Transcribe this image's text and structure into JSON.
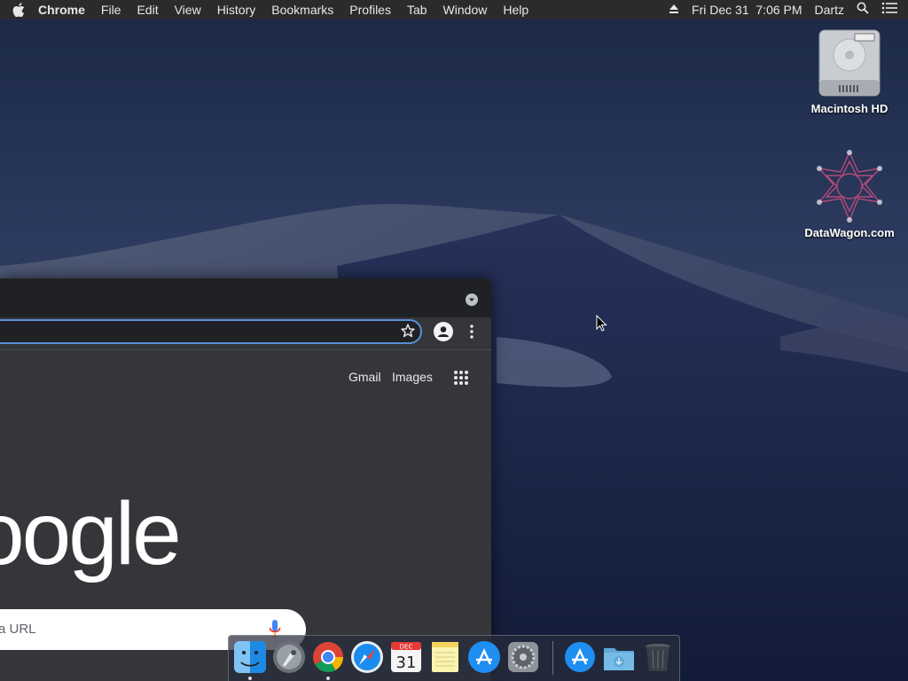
{
  "menubar": {
    "app_name": "Chrome",
    "menus": [
      "File",
      "Edit",
      "View",
      "History",
      "Bookmarks",
      "Profiles",
      "Tab",
      "Window",
      "Help"
    ],
    "datetime": "Fri Dec 31  7:06 PM",
    "user": "Dartz"
  },
  "desktop": {
    "icons": [
      {
        "label": "Macintosh HD",
        "icon": "hard-drive-icon"
      },
      {
        "label": "DataWagon.com",
        "icon": "datawagon-logo-icon"
      }
    ]
  },
  "chrome": {
    "links": {
      "gmail": "Gmail",
      "images": "Images"
    },
    "logo_text": "oogle",
    "search_placeholder": "a URL"
  },
  "dock": {
    "items": [
      {
        "name": "Finder",
        "icon": "finder-icon",
        "running": true
      },
      {
        "name": "Launchpad",
        "icon": "launchpad-icon",
        "running": false
      },
      {
        "name": "Google Chrome",
        "icon": "chrome-icon",
        "running": true
      },
      {
        "name": "Safari",
        "icon": "safari-icon",
        "running": false
      },
      {
        "name": "Calendar",
        "icon": "calendar-icon",
        "running": false
      },
      {
        "name": "Notes",
        "icon": "notes-icon",
        "running": false
      },
      {
        "name": "App Store",
        "icon": "app-store-icon",
        "running": false
      },
      {
        "name": "System Preferences",
        "icon": "system-preferences-icon",
        "running": false
      },
      {
        "name": "Applications",
        "icon": "applications-folder-icon",
        "running": false
      },
      {
        "name": "Downloads",
        "icon": "downloads-folder-icon",
        "running": false
      },
      {
        "name": "Trash",
        "icon": "trash-icon",
        "running": false
      }
    ],
    "calendar_month": "DEC",
    "calendar_day": "31"
  }
}
